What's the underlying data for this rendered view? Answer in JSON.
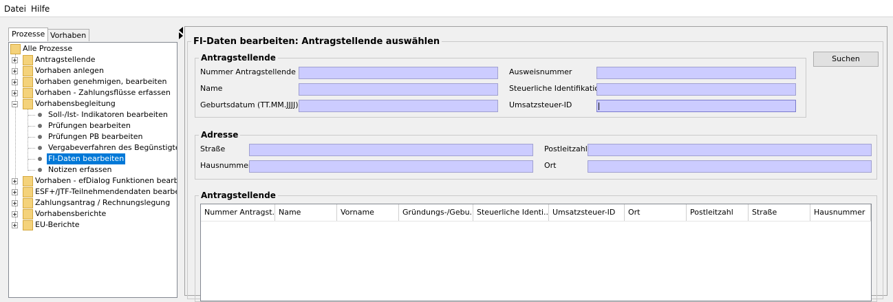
{
  "menu": {
    "items": [
      {
        "label": "Datei"
      },
      {
        "label": "Hilfe"
      }
    ]
  },
  "tabs": [
    {
      "label": "Prozesse"
    },
    {
      "label": "Vorhaben"
    }
  ],
  "tree": {
    "root": "Alle Prozesse",
    "items": [
      "Antragstellende",
      "Vorhaben anlegen",
      "Vorhaben genehmigen, bearbeiten",
      "Vorhaben - Zahlungsflüsse erfassen",
      "Vorhabensbegleitung"
    ],
    "children": [
      "Soll-/Ist- Indikatoren bearbeiten",
      "Prüfungen bearbeiten",
      "Prüfungen PB bearbeiten",
      "Vergabeverfahren des Begünstigten be",
      "FI-Daten bearbeiten",
      "Notizen erfassen"
    ],
    "items_after": [
      "Vorhaben - efDialog Funktionen bearbeiten",
      "ESF+/JTF-Teilnehmendendaten bearbeiten",
      "Zahlungsantrag / Rechnungslegung",
      "Vorhabensberichte",
      "EU-Berichte"
    ]
  },
  "form": {
    "title": "FI-Daten bearbeiten: Antragstellende auswählen",
    "search_button": "Suchen",
    "antragstellende": {
      "legend": "Antragstellende",
      "nummer_label": "Nummer Antragstellende",
      "name_label": "Name",
      "geburtsdatum_label": "Geburtsdatum (TT.MM.JJJJ)",
      "ausweis_label": "Ausweisnummer",
      "steuer_id_label": "Steuerliche Identifikation",
      "ust_label": "Umsatzsteuer-ID",
      "nummer_value": "",
      "name_value": "",
      "geburtsdatum_value": "",
      "ausweis_value": "",
      "steuer_id_value": "",
      "ust_value": ""
    },
    "adresse": {
      "legend": "Adresse",
      "strasse_label": "Straße",
      "hausnummer_label": "Hausnummer",
      "plz_label": "Postleitzahl",
      "ort_label": "Ort",
      "strasse_value": "",
      "hausnummer_value": "",
      "plz_value": "",
      "ort_value": ""
    },
    "results": {
      "legend": "Antragstellende",
      "columns": [
        "Nummer Antragst...",
        "Name",
        "Vorname",
        "Gründungs-/Gebu...",
        "Steuerliche Identi...",
        "Umsatzsteuer-ID",
        "Ort",
        "Postleitzahl",
        "Straße",
        "Hausnummer"
      ]
    }
  },
  "colors": {
    "input_bg": "#ccccff",
    "selection": "#0078d7",
    "folder": "#f4d27b"
  }
}
